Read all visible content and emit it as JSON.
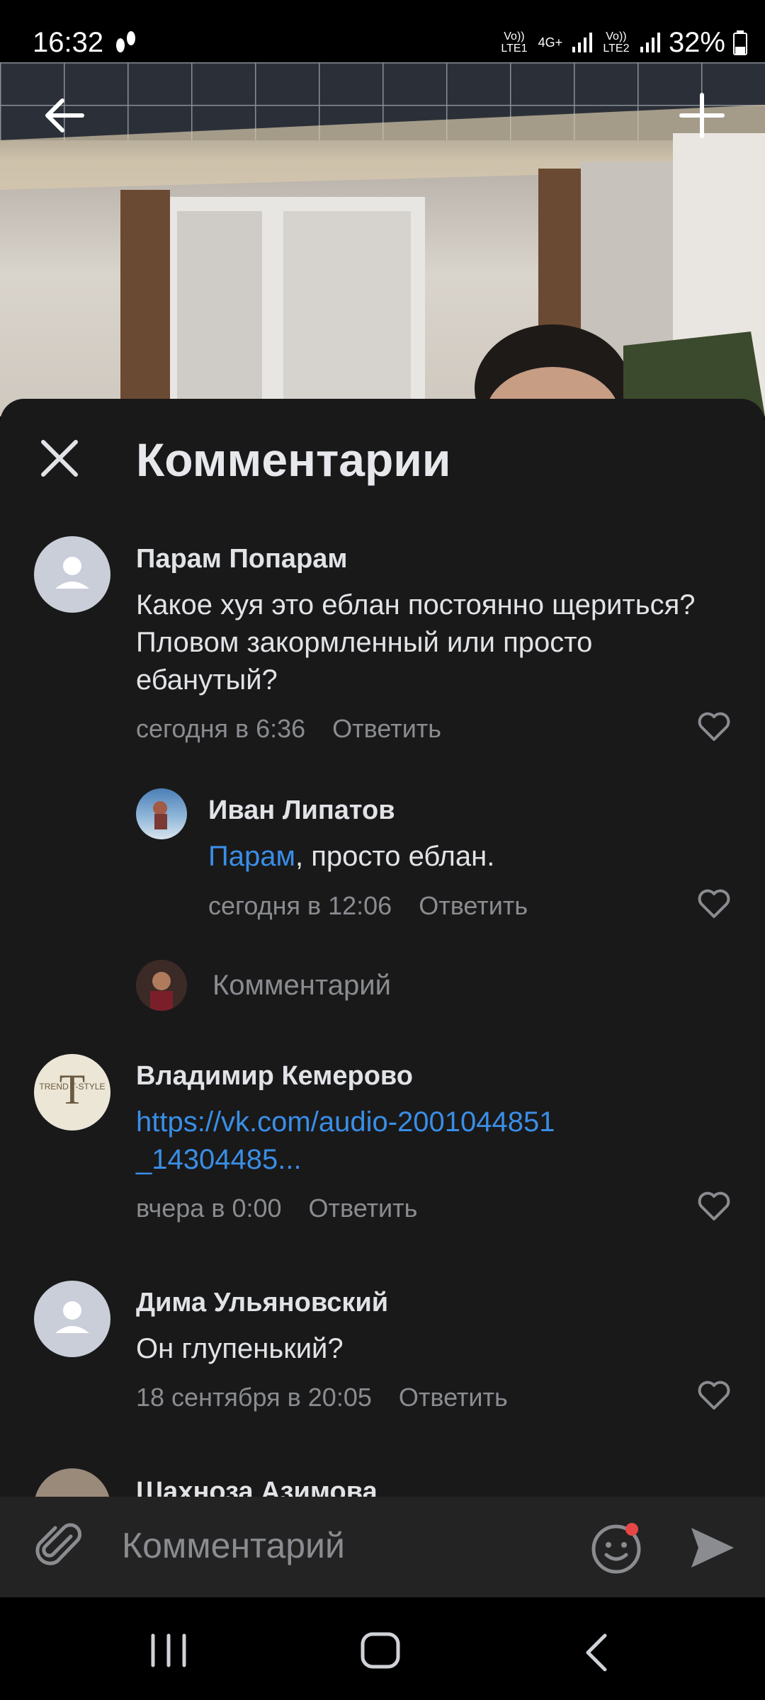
{
  "status_bar": {
    "time": "16:32",
    "network1": "Vo)) LTE1",
    "network_type": "4G+",
    "network2": "Vo)) LTE2",
    "battery": "32%"
  },
  "header": {
    "title": "Комментарии"
  },
  "comments": [
    {
      "author": "Парам Попарам",
      "text": "Какое хуя это еблан постоянно щериться? Пловом закормленный или просто ебанутый?",
      "time": "сегодня в 6:36",
      "reply_label": "Ответить"
    },
    {
      "author": "Иван Липатов",
      "mention": "Парам",
      "text": ", просто еблан.",
      "time": "сегодня в 12:06",
      "reply_label": "Ответить"
    },
    {
      "author": "Владимир Кемерово",
      "avatar_text": "TREND T-STYLE",
      "link_line1": "https://vk.com/audio-2001044851",
      "link_line2": "_14304485...",
      "time": "вчера в 0:00",
      "reply_label": "Ответить"
    },
    {
      "author": "Дима Ульяновский",
      "text": "Он глупенький?",
      "time": "18 сентября в 20:05",
      "reply_label": "Ответить"
    },
    {
      "author": "Шахноза Азимова"
    }
  ],
  "reply_input": {
    "placeholder": "Комментарий"
  },
  "comment_input": {
    "placeholder": "Комментарий"
  },
  "colors": {
    "panel_bg": "#19191a",
    "link": "#3a8ee6",
    "secondary_text": "#8a8c90",
    "notification_dot": "#e64646"
  }
}
